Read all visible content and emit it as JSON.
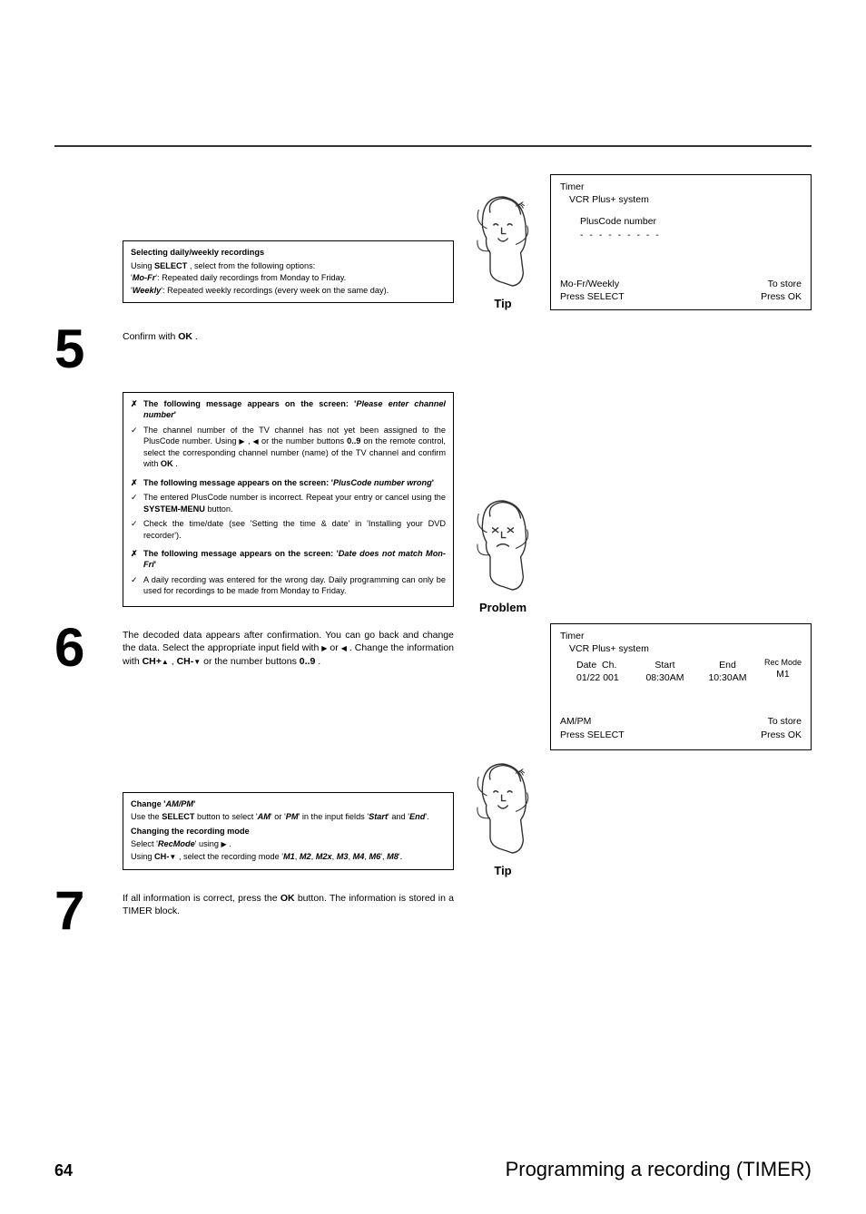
{
  "tip_box_1": {
    "title": "Selecting daily/weekly recordings",
    "line1_a": "Using ",
    "line1_b": "SELECT",
    "line1_c": " , select from the following options:",
    "line2_a": "'",
    "line2_b": "Mo-Fr",
    "line2_c": "': Repeated daily recordings from Monday to Friday.",
    "line3_a": "'",
    "line3_b": "Weekly",
    "line3_c": "': Repeated weekly recordings (every week on the same day)."
  },
  "tip_label": "Tip",
  "problem_label": "Problem",
  "screen1": {
    "line1": "Timer",
    "line2": "VCR Plus+ system",
    "line3": "PlusCode number",
    "dashes": "- - - - - - - - -",
    "bl1": "Mo-Fr/Weekly",
    "bl2": "Press SELECT",
    "br1": "To store",
    "br2": "Press OK"
  },
  "step5": {
    "num": "5",
    "text_a": "Confirm with ",
    "text_b": "OK",
    "text_c": " ."
  },
  "problem_box": {
    "l1_a": "The following message appears on the screen: '",
    "l1_b": "Please enter channel number",
    "l1_c": "'",
    "l2_a": "The channel number of the TV channel has not yet been assigned to the PlusCode number. Using ",
    "l2_b": " , ",
    "l2_c": " or the number buttons ",
    "l2_d": "0..9",
    "l2_e": " on the remote control, select the corresponding channel number (name) of the TV channel and confirm with ",
    "l2_f": "OK",
    "l2_g": " .",
    "l3_a": "The following message appears on the screen: '",
    "l3_b": "PlusCode number wrong",
    "l3_c": "'",
    "l4_a": "The entered PlusCode number is incorrect. Repeat your entry or cancel using the ",
    "l4_b": "SYSTEM-MENU",
    "l4_c": " button.",
    "l5": "Check the time/date (see 'Setting the time & date' in 'Installing your DVD recorder').",
    "l6_a": "The following message appears on the screen: '",
    "l6_b": "Date does not match Mon-Fri",
    "l6_c": "'",
    "l7": "A daily recording was entered for the wrong day. Daily programming can only be used for recordings to be made from Monday to Friday."
  },
  "step6": {
    "num": "6",
    "text_a": "The decoded data appears after confirmation. You can go back and change the data. Select the appropriate input field with ",
    "text_b": " or ",
    "text_c": " . Change the information with ",
    "text_d": "CH+",
    "text_e": " , ",
    "text_f": "CH-",
    "text_g": " or the number buttons ",
    "text_h": "0..9",
    "text_i": " ."
  },
  "tip_box_2": {
    "title_a": "Change '",
    "title_b": "AM/PM",
    "title_c": "'",
    "l1_a": "Use the ",
    "l1_b": "SELECT",
    "l1_c": " button to select '",
    "l1_d": "AM",
    "l1_e": "' or '",
    "l1_f": "PM",
    "l1_g": "' in the input fields '",
    "l1_h": "Start",
    "l1_i": "' and '",
    "l1_j": "End",
    "l1_k": "'.",
    "title2": "Changing the recording mode",
    "l2_a": "Select '",
    "l2_b": "RecMode",
    "l2_c": "' using ",
    "l2_d": " .",
    "l3_a": "Using ",
    "l3_b": "CH-",
    "l3_c": " , select the recording mode '",
    "l3_d": "M1",
    "l3_e": ", ",
    "l3_f": "M2",
    "l3_g": ", ",
    "l3_h": "M2x",
    "l3_i": ", ",
    "l3_j": "M3",
    "l3_k": ", ",
    "l3_l": "M4",
    "l3_m": ", ",
    "l3_n": "M6",
    "l3_o": "', ",
    "l3_p": "M8",
    "l3_q": "'."
  },
  "screen2": {
    "line1": "Timer",
    "line2": "VCR Plus+ system",
    "h_date": "Date",
    "h_ch": "Ch.",
    "h_start": "Start",
    "h_end": "End",
    "h_rec": "Rec Mode",
    "v_date": "01/22",
    "v_ch": "001",
    "v_start": "08:30AM",
    "v_end": "10:30AM",
    "v_rec": "M1",
    "bl1": "AM/PM",
    "bl2": "Press SELECT",
    "br1": "To store",
    "br2": "Press OK"
  },
  "step7": {
    "num": "7",
    "text_a": "If all information is correct, press the ",
    "text_b": "OK",
    "text_c": " button. The information is stored in a TIMER block."
  },
  "footer": {
    "page": "64",
    "title": "Programming a recording (TIMER)"
  }
}
